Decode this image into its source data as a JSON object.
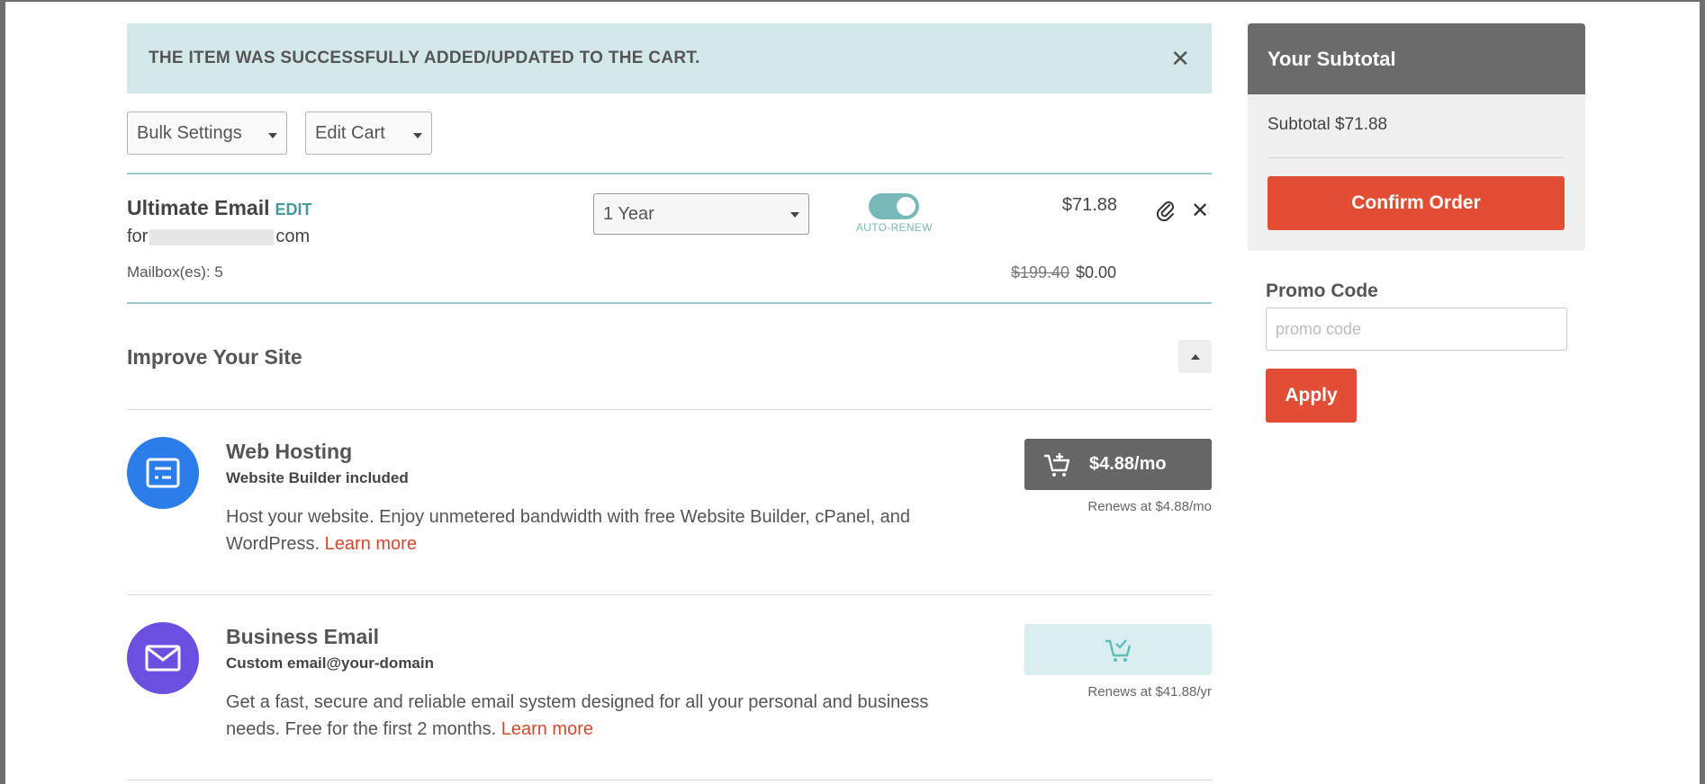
{
  "alert": {
    "message": "THE ITEM WAS SUCCESSFULLY ADDED/UPDATED TO THE CART."
  },
  "toolbar": {
    "bulk_settings": "Bulk Settings",
    "edit_cart": "Edit Cart"
  },
  "cart_item": {
    "name": "Ultimate Email",
    "edit_label": "EDIT",
    "for_prefix": "for",
    "domain_suffix": "com",
    "mailboxes": "Mailbox(es): 5",
    "term": "1 Year",
    "auto_renew_label": "AUTO-RENEW",
    "auto_renew_on": true,
    "price": "$71.88",
    "original_price": "$199.40",
    "discounted_price": "$0.00"
  },
  "improve": {
    "title": "Improve Your Site",
    "offers": [
      {
        "title": "Web Hosting",
        "subtitle": "Website Builder included",
        "description": "Host your website. Enjoy unmetered bandwidth with free Website Builder, cPanel, and WordPress.",
        "learn_more": "Learn more",
        "price_label": "$4.88/mo",
        "renews": "Renews at $4.88/mo",
        "icon": "server-icon",
        "icon_color": "#2b7de9"
      },
      {
        "title": "Business Email",
        "subtitle": "Custom email@your-domain",
        "description": "Get a fast, secure and reliable email system designed for all your personal and business needs. Free for the first 2 months.",
        "learn_more": "Learn more",
        "renews": "Renews at $41.88/yr",
        "icon": "envelope-icon",
        "icon_color": "#6a4fe0"
      }
    ]
  },
  "sidebar": {
    "title": "Your Subtotal",
    "subtotal": "Subtotal $71.88",
    "confirm_label": "Confirm Order",
    "promo_label": "Promo Code",
    "promo_placeholder": "promo code",
    "promo_value": "",
    "apply_label": "Apply"
  },
  "colors": {
    "alert_bg": "#d3e8e8",
    "accent_teal": "#79b8b9",
    "primary_button": "#e24e33",
    "link": "#d9472b"
  }
}
